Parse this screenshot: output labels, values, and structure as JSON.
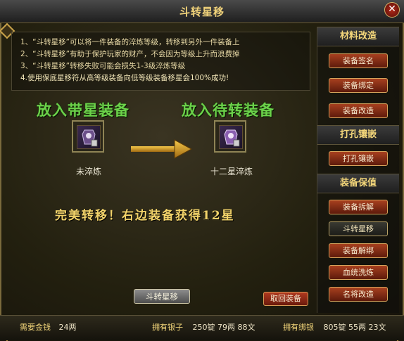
{
  "window": {
    "title": "斗转星移",
    "close_glyph": "✕"
  },
  "instructions": [
    "1、“斗转星移”可以将一件装备的淬炼等级，转移到另外一件装备上",
    "2、“斗转星移”有助于保护玩家的财产，不会因为等级上升而浪费掉",
    "3、“斗转星移”转移失败可能会损失1-3级淬炼等级",
    "4.使用保底星移符从高等级装备向低等级装备移星会100%成功!"
  ],
  "source": {
    "label": "放入带星装备",
    "item_name": "未淬炼",
    "icon": "armor-item-icon"
  },
  "target": {
    "label": "放入待转装备",
    "item_name": "十二星淬炼",
    "icon": "armor-item-icon"
  },
  "arrow_icon": "right-arrow-icon",
  "result_text": "完美转移！右边装备获得12星",
  "buttons": {
    "transfer": "斗转星移",
    "retrieve": "取回装备"
  },
  "side_panel": {
    "sections": [
      {
        "header": "材料改造",
        "items": [
          "装备签名",
          "装备绑定",
          "装备改造"
        ]
      },
      {
        "header": "打孔镶嵌",
        "items": [
          "打孔镶嵌"
        ]
      },
      {
        "header": "装备保值",
        "items": [
          "装备拆解",
          "斗转星移",
          "装备解绑",
          "血统洗炼",
          "名将改造"
        ]
      }
    ],
    "active_item": "斗转星移"
  },
  "status": {
    "cost_label": "需要金钱",
    "cost_value": "24两",
    "silver_label": "拥有银子",
    "silver_value": "250锭 79两 88文",
    "bound_label": "拥有绑银",
    "bound_value": "805锭 55两 23文"
  },
  "colors": {
    "accent_gold": "#f3d67a",
    "slot_label_green": "#6bd24a",
    "button_red": "#a8401f"
  }
}
